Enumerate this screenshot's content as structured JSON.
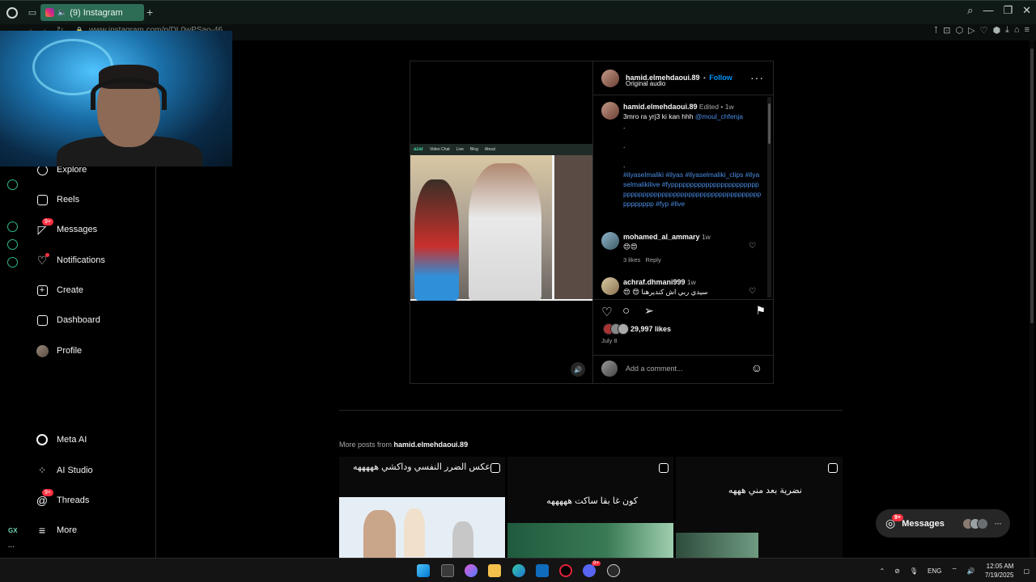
{
  "browser": {
    "tab_title": "(9) Instagram",
    "url": "www.instagram.com/p/DL0wPSao-46"
  },
  "nav": {
    "explore": "Explore",
    "reels": "Reels",
    "messages": "Messages",
    "messages_badge": "9+",
    "notifications": "Notifications",
    "create": "Create",
    "dashboard": "Dashboard",
    "profile": "Profile",
    "meta_ai": "Meta AI",
    "ai_studio": "AI Studio",
    "threads": "Threads",
    "threads_badge": "9+",
    "more": "More"
  },
  "strip": {
    "gx_label": "GX"
  },
  "post": {
    "media_app_brand": "azar",
    "media_nav": [
      "Video Chat",
      "Live",
      "Blog",
      "About"
    ],
    "author": "hamid.elmehdaoui.89",
    "follow": "Follow",
    "separator": "•",
    "audio": "Original audio",
    "caption": {
      "author": "hamid.elmehdaoui.89",
      "edited": "Edited",
      "age": "1w",
      "text": "3mro ra yrj3 ki kan hhh",
      "mention": "@moul_chfenja",
      "dots": [
        ".",
        ".",
        "."
      ],
      "hashtags": "#ilyaselmaliki #ilyas #ilyaselmaliki_clips #ilyaselmalikilive #fyppppppppppppppppppppppppppppppppppppppppppppppppppppppppppppppppppp #fyp #live"
    },
    "comments": [
      {
        "user": "mohamed_al_ammary",
        "age": "1w",
        "text": "😍😍",
        "likes": "3 likes",
        "reply": "Reply"
      },
      {
        "user": "achraf.dhmani999",
        "age": "1w",
        "text": "😍 😍 سيدي ربي اش كنديرهنا"
      }
    ],
    "likes": "29,997 likes",
    "date": "July 8",
    "add_comment_placeholder": "Add a comment..."
  },
  "more_posts": {
    "label": "More posts from",
    "author": "hamid.elmehdaoui.89",
    "items": [
      {
        "title": "عكس الضرر النفسي وداكشي هههههه"
      },
      {
        "title": "كون غا بقا ساكت هههههه"
      },
      {
        "title": "نضرية بعد مني هههه"
      }
    ]
  },
  "messages_pill": {
    "label": "Messages",
    "badge": "9+",
    "more": "···"
  },
  "taskbar": {
    "lang": "ENG",
    "time": "12:05 AM",
    "date": "7/19/2025",
    "discord_badge": "9+"
  },
  "colors": {
    "tab_active": "#2d6c55",
    "link_blue": "#4a8fe7",
    "follow_blue": "#0095f6",
    "badge_red": "#ff3040",
    "opera_gx_green": "#2fb88c"
  }
}
